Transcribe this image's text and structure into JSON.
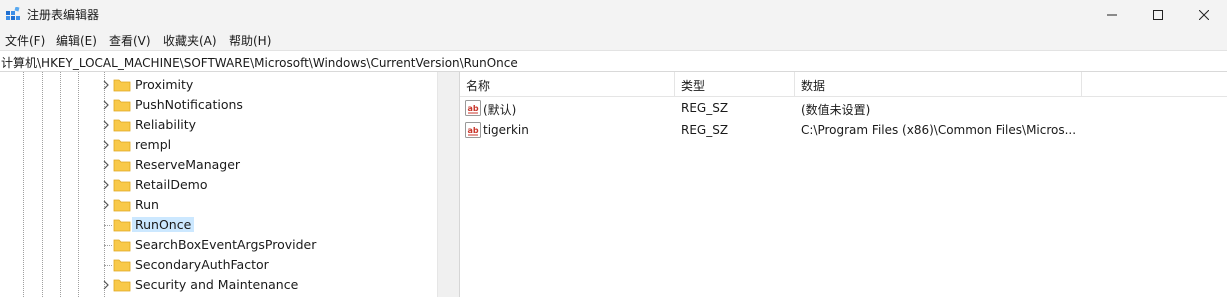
{
  "window": {
    "title": "注册表编辑器"
  },
  "menu": [
    "文件(F)",
    "编辑(E)",
    "查看(V)",
    "收藏夹(A)",
    "帮助(H)"
  ],
  "address": "计算机\\HKEY_LOCAL_MACHINE\\SOFTWARE\\Microsoft\\Windows\\CurrentVersion\\RunOnce",
  "tree": [
    {
      "label": "Proximity",
      "expandable": true,
      "selected": false
    },
    {
      "label": "PushNotifications",
      "expandable": true,
      "selected": false
    },
    {
      "label": "Reliability",
      "expandable": true,
      "selected": false
    },
    {
      "label": "rempl",
      "expandable": true,
      "selected": false
    },
    {
      "label": "ReserveManager",
      "expandable": true,
      "selected": false
    },
    {
      "label": "RetailDemo",
      "expandable": true,
      "selected": false
    },
    {
      "label": "Run",
      "expandable": true,
      "selected": false
    },
    {
      "label": "RunOnce",
      "expandable": false,
      "selected": true
    },
    {
      "label": "SearchBoxEventArgsProvider",
      "expandable": false,
      "selected": false
    },
    {
      "label": "SecondaryAuthFactor",
      "expandable": false,
      "selected": false
    },
    {
      "label": "Security and Maintenance",
      "expandable": true,
      "selected": false
    }
  ],
  "columns": {
    "name": "名称",
    "type": "类型",
    "data": "数据"
  },
  "values": [
    {
      "name": "(默认)",
      "type": "REG_SZ",
      "data": "(数值未设置)"
    },
    {
      "name": "tigerkin",
      "type": "REG_SZ",
      "data": "C:\\Program Files (x86)\\Common Files\\Micros..."
    }
  ],
  "colors": {
    "folder": "#f8c94a",
    "folder_dark": "#e0a820",
    "selection": "#cce8ff",
    "regicon_red": "#c8362b"
  }
}
